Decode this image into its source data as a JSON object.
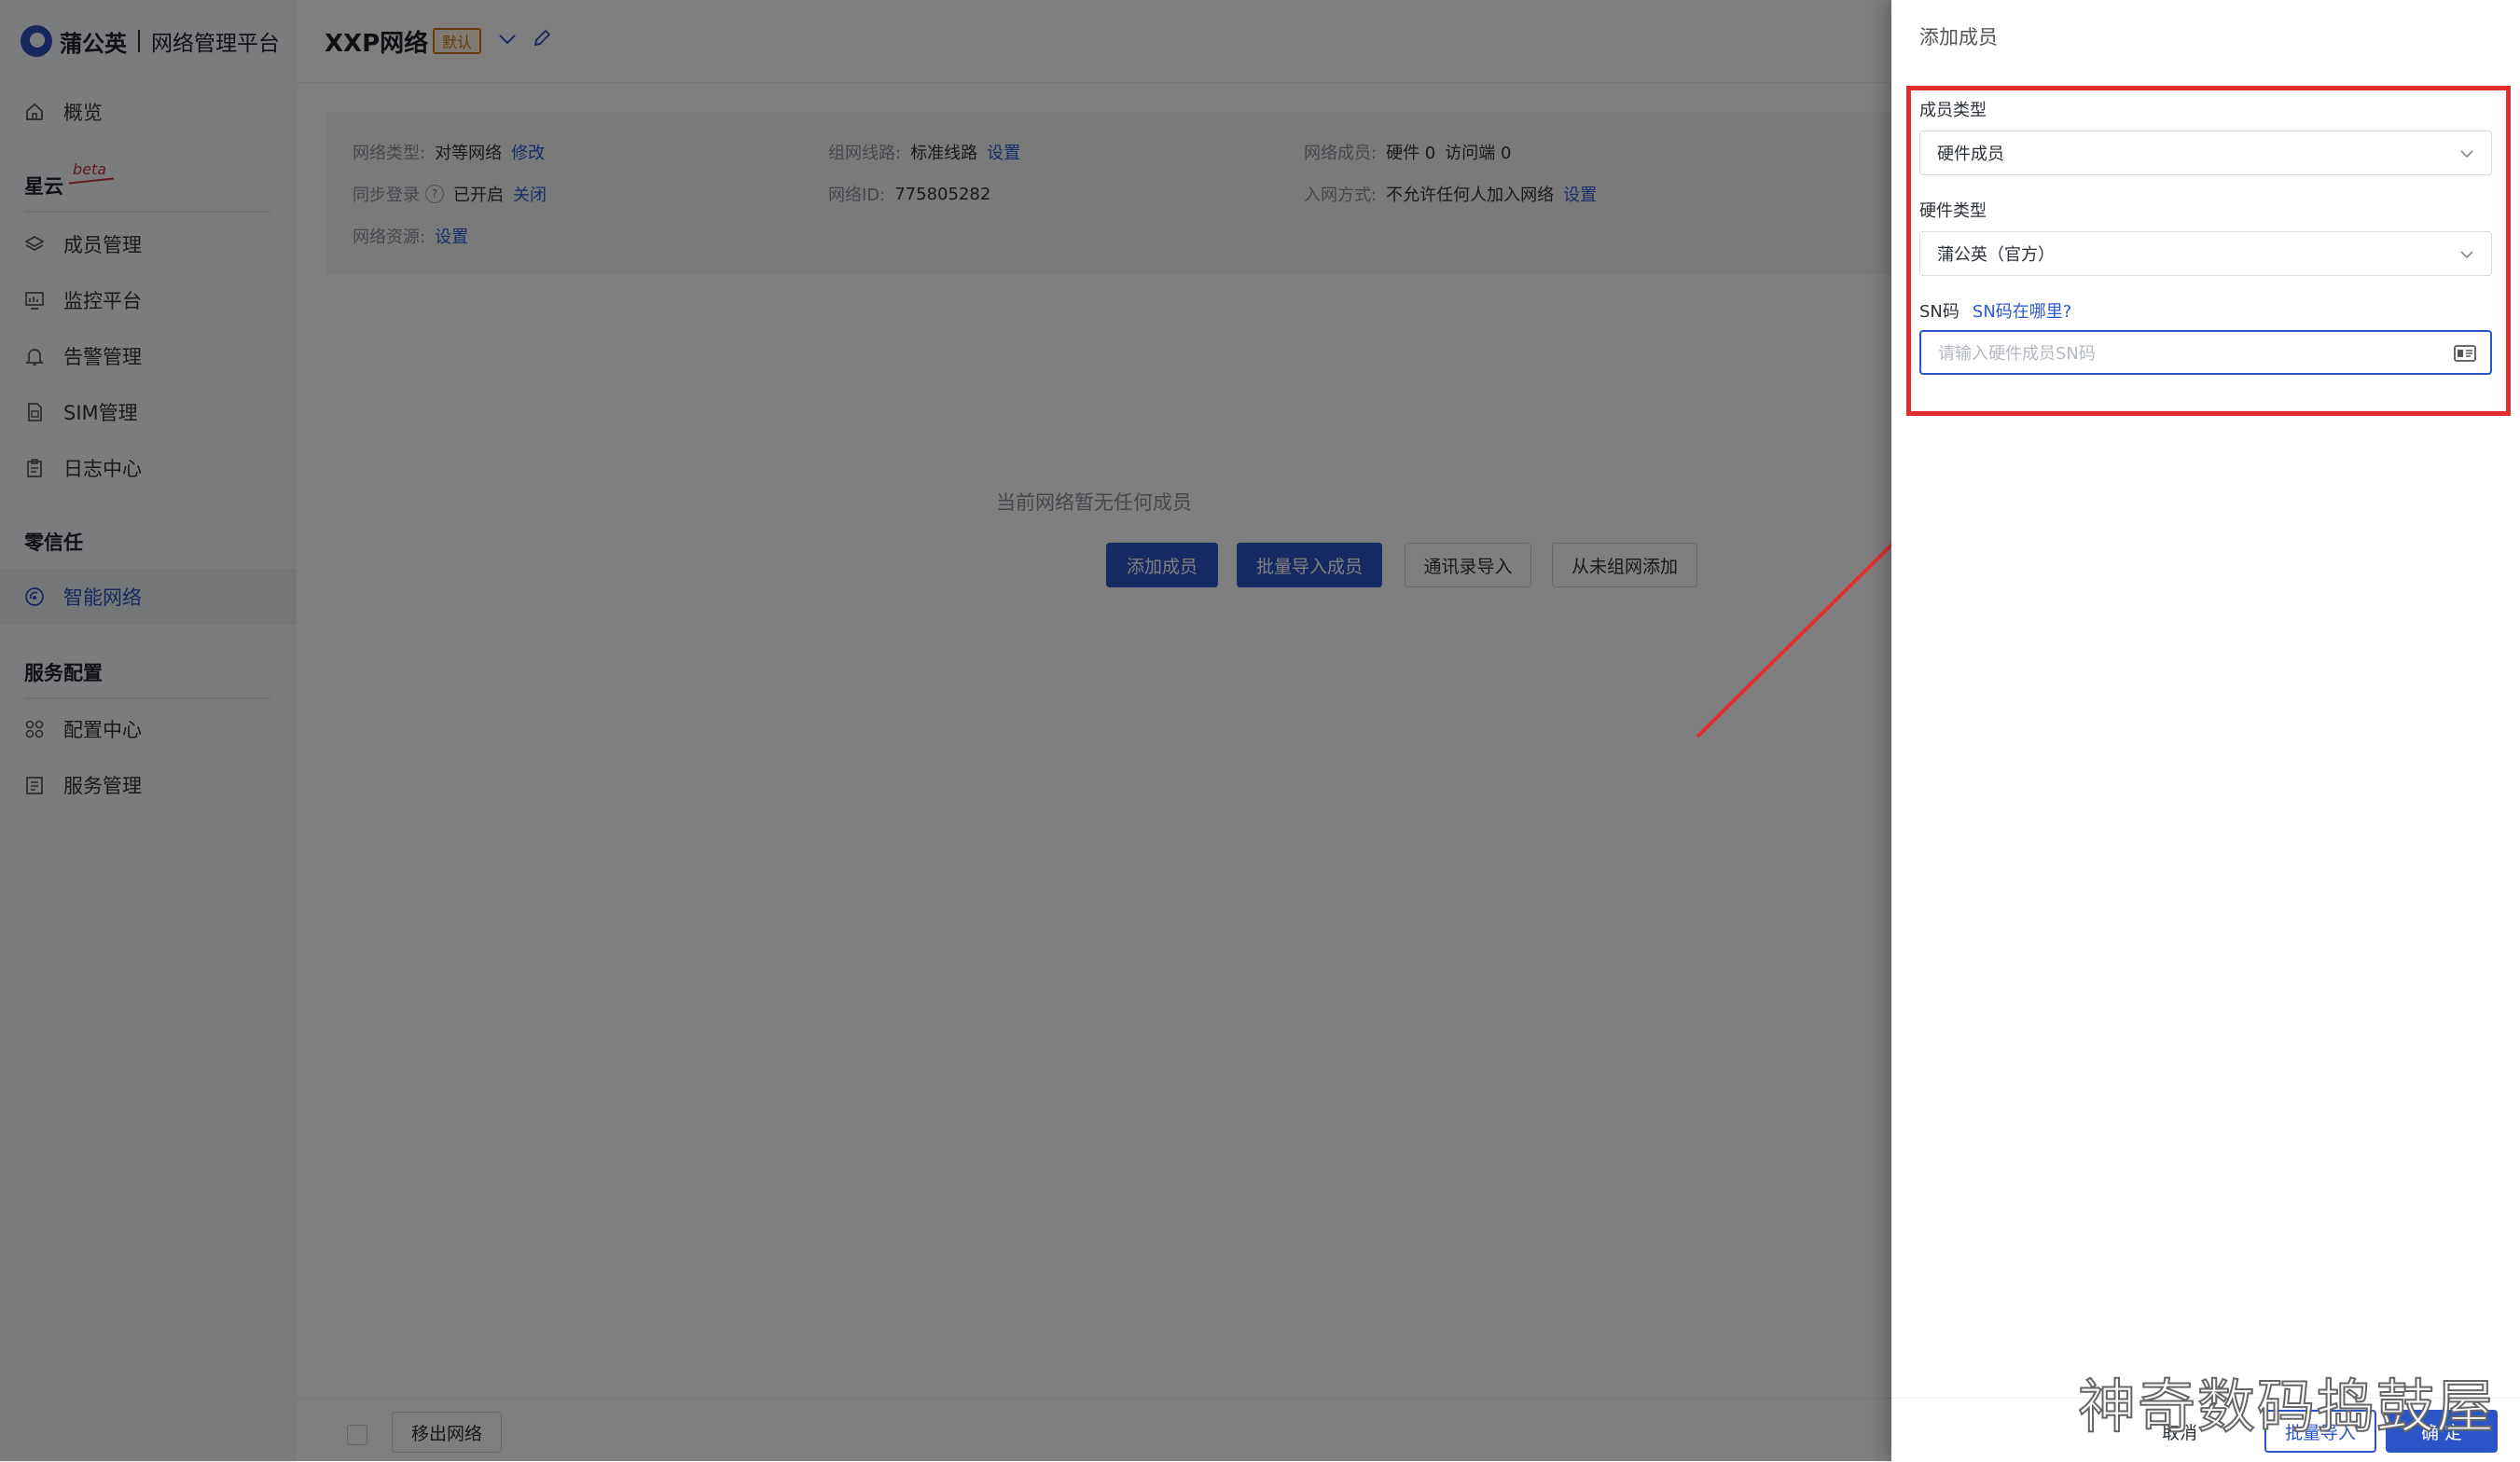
{
  "brand": {
    "name": "蒲公英",
    "subtitle": "网络管理平台"
  },
  "sidebar": {
    "overview": "概览",
    "group_xingyun": "星云",
    "beta": "beta",
    "xingyun_items": [
      "成员管理",
      "监控平台",
      "告警管理",
      "SIM管理",
      "日志中心"
    ],
    "group_zero_trust": "零信任",
    "zero_trust_items": [
      "智能网络"
    ],
    "group_service": "服务配置",
    "service_items": [
      "配置中心",
      "服务管理"
    ]
  },
  "header": {
    "network_name": "XXP网络",
    "default_badge": "默认"
  },
  "info": {
    "network_type_label": "网络类型:",
    "network_type_value": "对等网络",
    "network_type_action": "修改",
    "route_label": "组网线路:",
    "route_value": "标准线路",
    "route_action": "设置",
    "members_label": "网络成员:",
    "members_hw": "硬件 0",
    "members_visit": "访问端 0",
    "sync_label": "同步登录",
    "sync_value": "已开启",
    "sync_action": "关闭",
    "netid_label": "网络ID:",
    "netid_value": "775805282",
    "join_label": "入网方式:",
    "join_value": "不允许任何人加入网络",
    "join_action": "设置",
    "resource_label": "网络资源:",
    "resource_action": "设置"
  },
  "empty": {
    "text": "当前网络暂无任何成员",
    "add_member": "添加成员",
    "batch_import": "批量导入成员",
    "contacts_import": "通讯录导入",
    "from_ungrouped": "从未组网添加"
  },
  "bottom": {
    "remove_network": "移出网络"
  },
  "drawer": {
    "title": "添加成员",
    "member_type_label": "成员类型",
    "member_type_value": "硬件成员",
    "hw_type_label": "硬件类型",
    "hw_type_value": "蒲公英（官方）",
    "sn_label": "SN码",
    "sn_help": "SN码在哪里?",
    "sn_placeholder": "请输入硬件成员SN码",
    "cancel": "取消",
    "batch_import": "批量导入",
    "confirm": "确 定"
  },
  "watermark": "神奇数码捣鼓屋",
  "colors": {
    "primary": "#2b55c7",
    "highlight": "#e02d2d",
    "badge": "#c9770c"
  }
}
